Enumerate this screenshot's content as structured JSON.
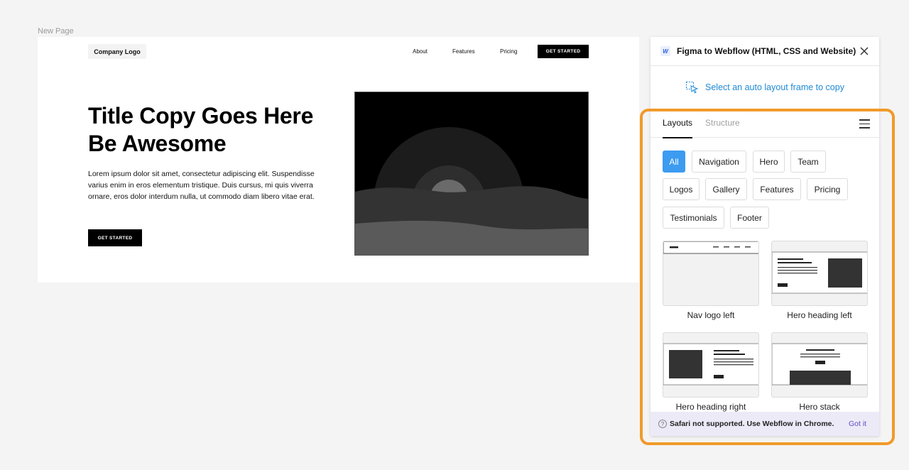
{
  "canvas": {
    "page_label": "New Page"
  },
  "frame": {
    "logo": "Company Logo",
    "nav": {
      "about": "About",
      "features": "Features",
      "pricing": "Pricing",
      "cta": "GET STARTED"
    },
    "hero": {
      "title": "Title Copy Goes Here Be Awesome",
      "body": "Lorem ipsum dolor sit amet, consectetur adipiscing elit. Suspendisse varius enim in eros elementum tristique. Duis cursus, mi quis viverra ornare, eros dolor interdum nulla, ut commodo diam libero vitae erat.",
      "cta": "GET STARTED"
    }
  },
  "panel": {
    "icon_letter": "W",
    "title": "Figma to Webflow (HTML, CSS and Website)",
    "select_hint": "Select an auto layout frame to copy",
    "tabs": [
      {
        "label": "Layouts",
        "active": true
      },
      {
        "label": "Structure",
        "active": false
      }
    ],
    "chips": [
      {
        "label": "All",
        "active": true
      },
      {
        "label": "Navigation"
      },
      {
        "label": "Hero"
      },
      {
        "label": "Team"
      },
      {
        "label": "Logos"
      },
      {
        "label": "Gallery"
      },
      {
        "label": "Features"
      },
      {
        "label": "Pricing"
      },
      {
        "label": "Testimonials"
      },
      {
        "label": "Footer"
      }
    ],
    "cards": [
      {
        "label": "Nav logo left"
      },
      {
        "label": "Hero heading left"
      },
      {
        "label": "Hero heading right"
      },
      {
        "label": "Hero stack"
      }
    ],
    "notice": {
      "text": "Safari not supported. Use Webflow in Chrome.",
      "action": "Got it"
    }
  },
  "colors": {
    "accent": "#3d9bf0",
    "link": "#1f8ad6",
    "highlight": "#f09a2a",
    "notice_bg": "#edeaf8"
  }
}
